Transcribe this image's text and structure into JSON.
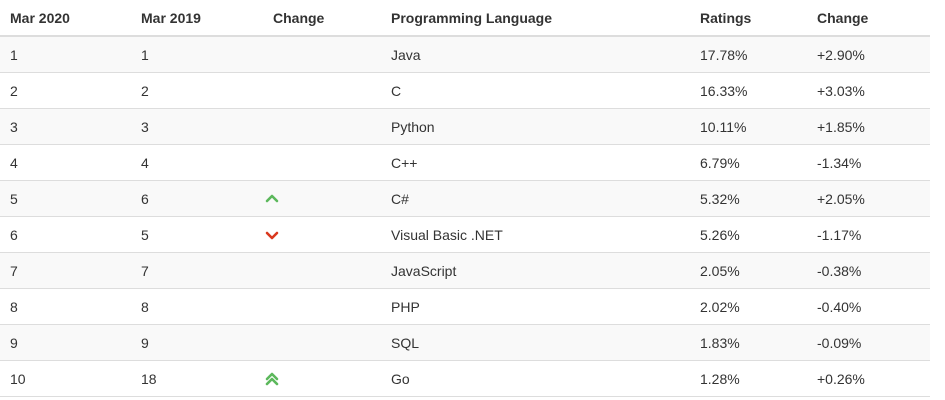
{
  "colors": {
    "up": "#5cb85c",
    "down": "#d9381e",
    "border": "#dddddd",
    "stripe": "#f9f9f9",
    "text": "#333333"
  },
  "table": {
    "headers": [
      "Mar 2020",
      "Mar 2019",
      "Change",
      "Programming Language",
      "Ratings",
      "Change"
    ],
    "rows": [
      {
        "rank_2020": "1",
        "rank_2019": "1",
        "trend": "none",
        "language": "Java",
        "rating": "17.78%",
        "change": "+2.90%"
      },
      {
        "rank_2020": "2",
        "rank_2019": "2",
        "trend": "none",
        "language": "C",
        "rating": "16.33%",
        "change": "+3.03%"
      },
      {
        "rank_2020": "3",
        "rank_2019": "3",
        "trend": "none",
        "language": "Python",
        "rating": "10.11%",
        "change": "+1.85%"
      },
      {
        "rank_2020": "4",
        "rank_2019": "4",
        "trend": "none",
        "language": "C++",
        "rating": "6.79%",
        "change": "-1.34%"
      },
      {
        "rank_2020": "5",
        "rank_2019": "6",
        "trend": "up",
        "language": "C#",
        "rating": "5.32%",
        "change": "+2.05%"
      },
      {
        "rank_2020": "6",
        "rank_2019": "5",
        "trend": "down",
        "language": "Visual Basic .NET",
        "rating": "5.26%",
        "change": "-1.17%"
      },
      {
        "rank_2020": "7",
        "rank_2019": "7",
        "trend": "none",
        "language": "JavaScript",
        "rating": "2.05%",
        "change": "-0.38%"
      },
      {
        "rank_2020": "8",
        "rank_2019": "8",
        "trend": "none",
        "language": "PHP",
        "rating": "2.02%",
        "change": "-0.40%"
      },
      {
        "rank_2020": "9",
        "rank_2019": "9",
        "trend": "none",
        "language": "SQL",
        "rating": "1.83%",
        "change": "-0.09%"
      },
      {
        "rank_2020": "10",
        "rank_2019": "18",
        "trend": "double-up",
        "language": "Go",
        "rating": "1.28%",
        "change": "+0.26%"
      }
    ]
  },
  "icons": {
    "up": "chevron-up-icon",
    "down": "chevron-down-icon",
    "double-up": "double-chevron-up-icon"
  }
}
